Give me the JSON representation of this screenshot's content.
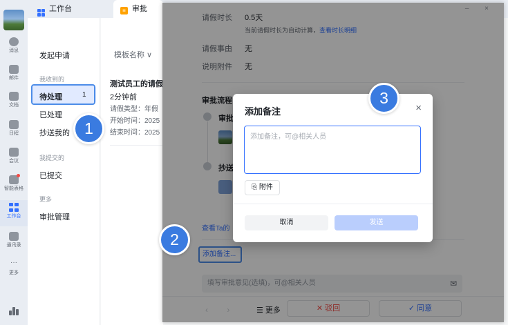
{
  "rail": {
    "items": [
      {
        "label": "消息"
      },
      {
        "label": "邮件"
      },
      {
        "label": "文档"
      },
      {
        "label": "日程"
      },
      {
        "label": "会议"
      },
      {
        "label": "智能表格"
      },
      {
        "label": "工作台"
      },
      {
        "label": "通讯录"
      },
      {
        "label": "更多"
      }
    ]
  },
  "tabs": {
    "workbench": "工作台",
    "approval": "审批",
    "approval_icon": "≡"
  },
  "sidebar": {
    "start": "发起申请",
    "received_header": "我收到的",
    "pending": "待处理",
    "pending_count": "1",
    "handled": "已处理",
    "cc": "抄送我的",
    "submitted_header": "我提交的",
    "submitted": "已提交",
    "more_header": "更多",
    "manage": "审批管理"
  },
  "list": {
    "filter": "模板名称 ∨",
    "card": {
      "title": "测试员工的请假",
      "time_ago": "2分钟前",
      "line1": "请假类型：年假",
      "line2": "开始时间：2025",
      "line3": "结束时间：2025"
    }
  },
  "detail": {
    "window_controls": "– ×",
    "duration_label": "请假时长",
    "duration_value": "0.5天",
    "duration_hint": "当前请假时长为自动计算，",
    "duration_hint_link": "查看时长明细",
    "reason_label": "请假事由",
    "reason_value": "无",
    "attachment_label": "说明附件",
    "attachment_value": "无",
    "flow_title": "审批流程",
    "node1_label": "审批",
    "node2_label": "抄送",
    "more_link": "查看Ta的",
    "add_note_link": "添加备注...",
    "comment_placeholder": "填写审批意见(选填)，可@相关人员",
    "nav_arrows": "‹ ›",
    "more_button": "☰ 更多",
    "reject_button": "✕ 驳回",
    "agree_button": "✓ 同意"
  },
  "modal": {
    "title": "添加备注",
    "close": "×",
    "placeholder": "添加备注，可@相关人员",
    "attach_button": "附件",
    "cancel_button": "取消",
    "send_button": "发送"
  },
  "callouts": {
    "one": "1",
    "two": "2",
    "three": "3"
  },
  "colors": {
    "accent": "#3370ff",
    "callout": "#3a7be0",
    "reject": "#f54a45"
  }
}
